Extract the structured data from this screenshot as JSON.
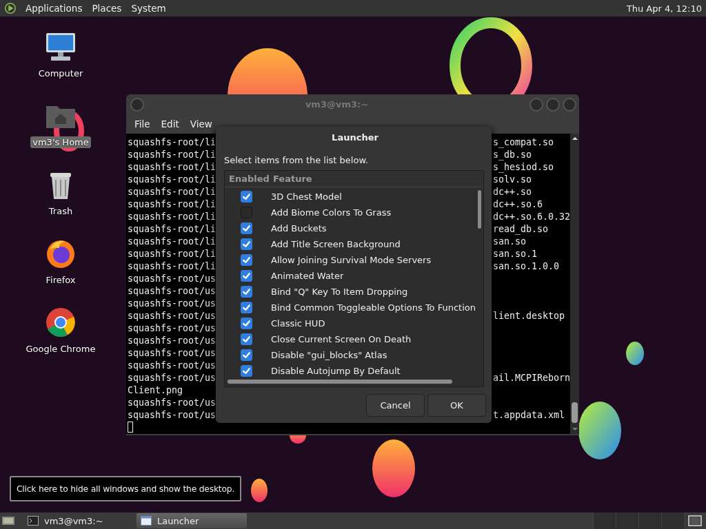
{
  "top_panel": {
    "menus": [
      "Applications",
      "Places",
      "System"
    ],
    "clock": "Thu Apr  4, 12:10"
  },
  "desktop_icons": [
    {
      "label": "Computer",
      "kind": "computer",
      "selected": false
    },
    {
      "label": "vm3's Home",
      "kind": "home",
      "selected": true
    },
    {
      "label": "Trash",
      "kind": "trash",
      "selected": false
    },
    {
      "label": "Firefox",
      "kind": "firefox",
      "selected": false
    },
    {
      "label": "Google Chrome",
      "kind": "chrome",
      "selected": false
    }
  ],
  "terminal": {
    "title": "vm3@vm3:~",
    "menus": [
      "File",
      "Edit",
      "View"
    ],
    "lines": [
      {
        "left": "squashfs-root/li",
        "right": "s_compat.so"
      },
      {
        "left": "squashfs-root/li",
        "right": "s_db.so"
      },
      {
        "left": "squashfs-root/li",
        "right": "s_hesiod.so"
      },
      {
        "left": "squashfs-root/li",
        "right": "solv.so"
      },
      {
        "left": "squashfs-root/li",
        "right": "dc++.so"
      },
      {
        "left": "squashfs-root/li",
        "right": "dc++.so.6"
      },
      {
        "left": "squashfs-root/li",
        "right": "dc++.so.6.0.32"
      },
      {
        "left": "squashfs-root/li",
        "right": "read_db.so"
      },
      {
        "left": "squashfs-root/li",
        "right": "san.so"
      },
      {
        "left": "squashfs-root/li",
        "right": "san.so.1"
      },
      {
        "left": "squashfs-root/li",
        "right": "san.so.1.0.0"
      },
      {
        "left": "squashfs-root/us"
      },
      {
        "left": "squashfs-root/us"
      },
      {
        "left": "squashfs-root/us"
      },
      {
        "left": "squashfs-root/us",
        "right": "lient.desktop"
      },
      {
        "left": "squashfs-root/us"
      },
      {
        "left": "squashfs-root/us"
      },
      {
        "left": "squashfs-root/us"
      },
      {
        "left": "squashfs-root/us"
      },
      {
        "left": "squashfs-root/us",
        "right": "ail.MCPIReborn"
      },
      {
        "left": "Client.png"
      },
      {
        "left": "squashfs-root/us"
      },
      {
        "left": "squashfs-root/us",
        "right": "t.appdata.xml"
      }
    ]
  },
  "dialog": {
    "title": "Launcher",
    "instruction": "Select items from the list below.",
    "columns": [
      "Enabled",
      "Feature"
    ],
    "rows": [
      {
        "feature": "3D Chest Model",
        "checked": true
      },
      {
        "feature": "Add Biome Colors To Grass",
        "checked": false
      },
      {
        "feature": "Add Buckets",
        "checked": true
      },
      {
        "feature": "Add Title Screen Background",
        "checked": true
      },
      {
        "feature": "Allow Joining Survival Mode Servers",
        "checked": true
      },
      {
        "feature": "Animated Water",
        "checked": true
      },
      {
        "feature": "Bind \"Q\" Key To Item Dropping",
        "checked": true
      },
      {
        "feature": "Bind Common Toggleable Options To Function",
        "checked": true
      },
      {
        "feature": "Classic HUD",
        "checked": true
      },
      {
        "feature": "Close Current Screen On Death",
        "checked": true
      },
      {
        "feature": "Disable \"gui_blocks\" Atlas",
        "checked": true
      },
      {
        "feature": "Disable Autojump By Default",
        "checked": true
      }
    ],
    "buttons": [
      "Cancel",
      "OK"
    ]
  },
  "tooltip": "Click here to hide all windows and show the desktop.",
  "taskbar": {
    "items": [
      {
        "label": "vm3@vm3:~",
        "kind": "terminal",
        "selected": false
      },
      {
        "label": "Launcher",
        "kind": "window",
        "selected": true
      }
    ]
  }
}
